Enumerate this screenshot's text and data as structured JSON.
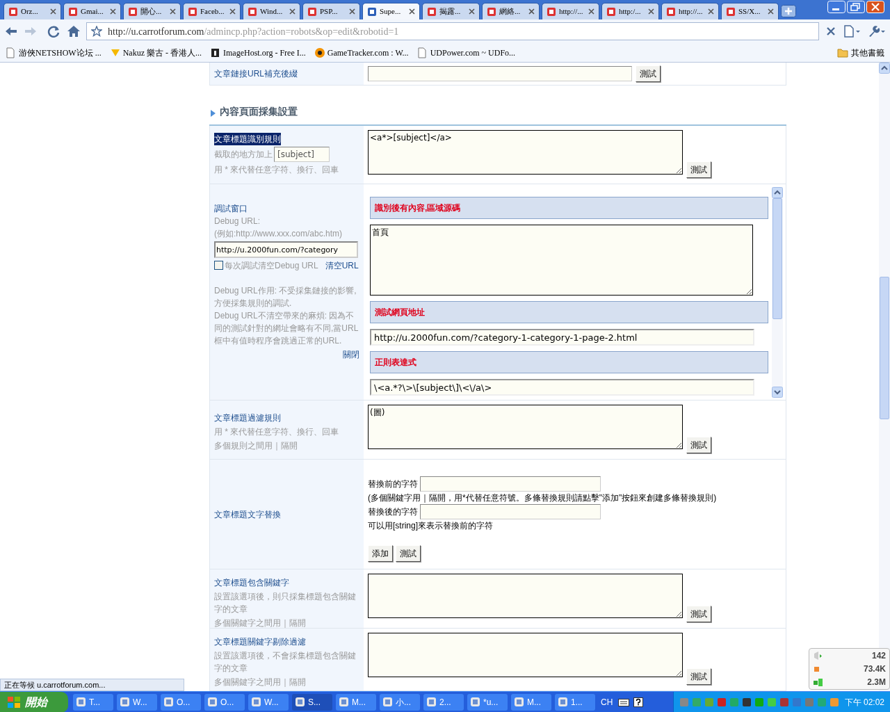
{
  "browser": {
    "tabs": [
      {
        "label": "Orz...",
        "selected": false
      },
      {
        "label": "Gmai...",
        "selected": false
      },
      {
        "label": "開心...",
        "selected": false
      },
      {
        "label": "Faceb...",
        "selected": false
      },
      {
        "label": "Wind...",
        "selected": false
      },
      {
        "label": "PSP...",
        "selected": false
      },
      {
        "label": "Supe...",
        "selected": true
      },
      {
        "label": "揭露...",
        "selected": false
      },
      {
        "label": "網絡...",
        "selected": false
      },
      {
        "label": "http://...",
        "selected": false
      },
      {
        "label": "http:/...",
        "selected": false
      },
      {
        "label": "http://...",
        "selected": false
      },
      {
        "label": "SS/X...",
        "selected": false
      }
    ],
    "url_host": "http://u.carrotforum.com",
    "url_path": "/admincp.php?action=robots&op=edit&robotid=1",
    "bookmarks": [
      "游俠NETSHOW论坛 ...",
      "Nakuz 樂古 - 香港人...",
      "ImageHost.org - Free I...",
      "GameTracker.com : W...",
      "UDPower.com ~ UDFo..."
    ],
    "other_bookmarks": "其他書籤"
  },
  "page": {
    "top_row": {
      "label": "文章鏈接URL補充後綴",
      "button": "測試"
    },
    "section_title": "內容頁面採集設置",
    "rows": [
      {
        "kind": "textarea",
        "label": "文章標題識別規則",
        "label_highlighted": true,
        "hint_prefix": "截取的地方加上",
        "hint_field": {
          "value": "[subject]"
        },
        "notes": [
          "用 * 來代替任意字符、換行、回車"
        ],
        "value": "<a*>[subject]</a>",
        "button": "測試"
      },
      {
        "kind": "debug",
        "label": "調試窗口",
        "notes": [
          "Debug URL:",
          "(例如:http://www.xxx.com/abc.htm)"
        ],
        "url_value": "http://u.2000fun.com/?category",
        "checkbox": {
          "label": "每次調試清空Debug URL",
          "checked": false
        },
        "clear_link": "清空URL",
        "explain": [
          "Debug URL作用: 不受採集鏈接的影響,方便採集規則的調試.",
          "Debug URL不清空帶來的麻煩: 因為不同的測試針對的網址會略有不同,當URL框中有值時程序會跳過正常的URL."
        ],
        "close_link": "關閉",
        "panel": [
          {
            "title": "識別後有內容,區域源碼",
            "kind": "textarea",
            "value": "首頁"
          },
          {
            "title": "測試網頁地址",
            "kind": "input",
            "value": "http://u.2000fun.com/?category-1-category-1-page-2.html"
          },
          {
            "title": "正則表達式",
            "kind": "input",
            "value": "\\<a.*?\\>\\[subject\\]\\<\\/a\\>"
          }
        ]
      },
      {
        "kind": "textarea",
        "label": "文章標題過濾規則",
        "label_highlighted": false,
        "notes": [
          "用 * 來代替任意字符、換行、回車",
          "多個規則之間用｜隔開"
        ],
        "value": "(圖)",
        "button": "測試"
      },
      {
        "kind": "replace",
        "label": "文章標題文字替換",
        "before_label": "替換前的字符",
        "note": "(多個關鍵字用｜隔開，用*代替任意符號。多條替換規則請點擊\"添加\"按鈕來創建多條替換規則)",
        "after_label": "替換後的字符",
        "note2": "可以用[string]來表示替換前的字符",
        "buttons": [
          "添加",
          "測試"
        ]
      },
      {
        "kind": "textarea",
        "label": "文章標題包含關鍵字",
        "label_highlighted": false,
        "notes": [
          "設置該選項後，則只採集標題包含關鍵字的文章",
          "多個關鍵字之間用｜隔開"
        ],
        "value": "",
        "button": "測試"
      },
      {
        "kind": "textarea",
        "label": "文章標題關鍵字剔除過濾",
        "label_highlighted": false,
        "notes": [
          "設置該選項後，不會採集標題包含關鍵字的文章",
          "多個關鍵字之間用｜隔開"
        ],
        "value": "",
        "button": "測試"
      }
    ]
  },
  "status_text": "正在等候 u.carrotforum.com...",
  "tray_widget": [
    "142",
    "73.4K",
    "2.3M"
  ],
  "taskbar": {
    "start": "開始",
    "items": [
      {
        "label": "T...",
        "selected": false
      },
      {
        "label": "W...",
        "selected": false
      },
      {
        "label": "O...",
        "selected": false
      },
      {
        "label": "O...",
        "selected": false
      },
      {
        "label": "W...",
        "selected": false
      },
      {
        "label": "S...",
        "selected": true
      },
      {
        "label": "M...",
        "selected": false
      },
      {
        "label": "小...",
        "selected": false
      },
      {
        "label": "2...",
        "selected": false
      },
      {
        "label": "*u...",
        "selected": false
      },
      {
        "label": "M...",
        "selected": false
      },
      {
        "label": "1...",
        "selected": false
      }
    ],
    "language": "CH",
    "clock": "下午 02:02"
  }
}
